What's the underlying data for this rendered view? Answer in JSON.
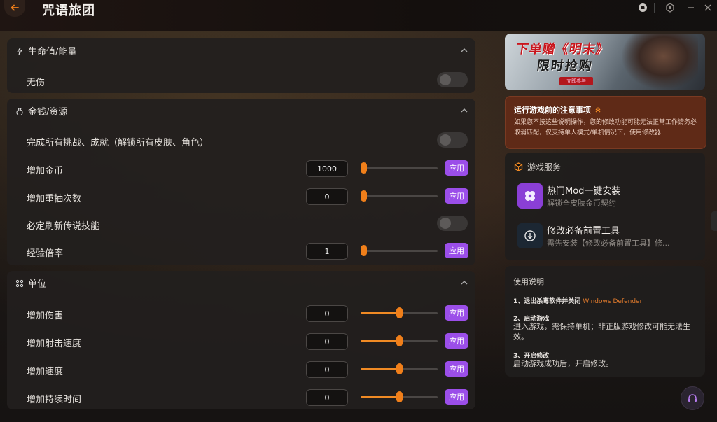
{
  "app": {
    "title": "咒语旅团"
  },
  "sections": {
    "health": {
      "title": "生命值/能量",
      "rows": [
        {
          "label": "无伤",
          "type": "toggle"
        }
      ]
    },
    "money": {
      "title": "金钱/资源",
      "rows": [
        {
          "label": "完成所有挑战、成就（解锁所有皮肤、角色）",
          "type": "toggle"
        },
        {
          "label": "增加金币",
          "type": "input",
          "value": "1000",
          "slider": 0.0,
          "apply": "应用"
        },
        {
          "label": "增加重抽次数",
          "type": "input",
          "value": "0",
          "slider": 0.0,
          "apply": "应用"
        },
        {
          "label": "必定刷新传说技能",
          "type": "toggle"
        },
        {
          "label": "经验倍率",
          "type": "input",
          "value": "1",
          "slider": 0.0,
          "apply": "应用"
        }
      ]
    },
    "unit": {
      "title": "单位",
      "rows": [
        {
          "label": "增加伤害",
          "type": "input",
          "value": "0",
          "slider": 0.5,
          "apply": "应用"
        },
        {
          "label": "增加射击速度",
          "type": "input",
          "value": "0",
          "slider": 0.5,
          "apply": "应用"
        },
        {
          "label": "增加速度",
          "type": "input",
          "value": "0",
          "slider": 0.5,
          "apply": "应用"
        },
        {
          "label": "增加持续时间",
          "type": "input",
          "value": "0",
          "slider": 0.5,
          "apply": "应用"
        }
      ]
    }
  },
  "banner": {
    "line1": "下单赠《明末》",
    "line2": "限时抢购",
    "cta": "立即参与"
  },
  "notice": {
    "title": "运行游戏前的注意事项",
    "body": "如果您不按这些说明操作，您的修改功能可能无法正常工作请务必取消匹配，仅支持单人模式/单机情况下，使用修改器"
  },
  "services": {
    "title": "游戏服务",
    "items": [
      {
        "title": "热门Mod一键安装",
        "subtitle": "解锁全皮肤金币契约"
      },
      {
        "title": "修改必备前置工具",
        "subtitle": "需先安装【修改必备前置工具】修..."
      }
    ]
  },
  "guide": {
    "title": "使用说明",
    "step1": "1、退出杀毒软件并关闭",
    "step1_highlight": "Windows Defender",
    "step2": "2、启动游戏",
    "step2_desc": "进入游戏，需保持单机；非正版游戏修改可能无法生效。",
    "step3": "3、开启修改",
    "step3_desc": "启动游戏成功后，开启修改。"
  },
  "colors": {
    "accent": "#f08a24",
    "apply": "#9b4ee9",
    "notice_bg": "#5f2a17"
  }
}
